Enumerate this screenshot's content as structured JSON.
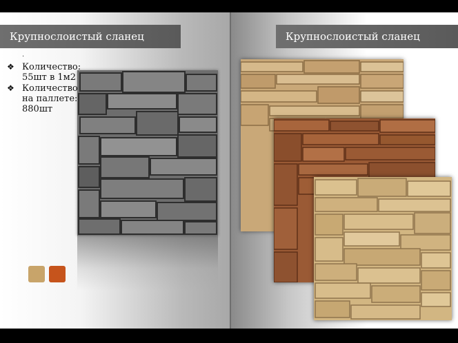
{
  "left_panel": {
    "title": "Крупнослоистый сланец",
    "dot": ".",
    "bullets": [
      {
        "marker": "❖",
        "text": "Количество:\n55шт в 1м2"
      },
      {
        "marker": "❖",
        "text": "Количество\nна паллете:\n880шт"
      }
    ],
    "swatches": [
      {
        "name": "sand",
        "color": "#c8a46a"
      },
      {
        "name": "rust",
        "color": "#c6541c"
      }
    ]
  },
  "right_panel": {
    "title": "Крупнослоистый сланец"
  },
  "colors": {
    "title_bar": "#666666",
    "gray_stone": "#6d6d6d",
    "sand_stone": "#c9a878",
    "brown_stone": "#9a5a35",
    "beige_stone": "#d2b682"
  }
}
